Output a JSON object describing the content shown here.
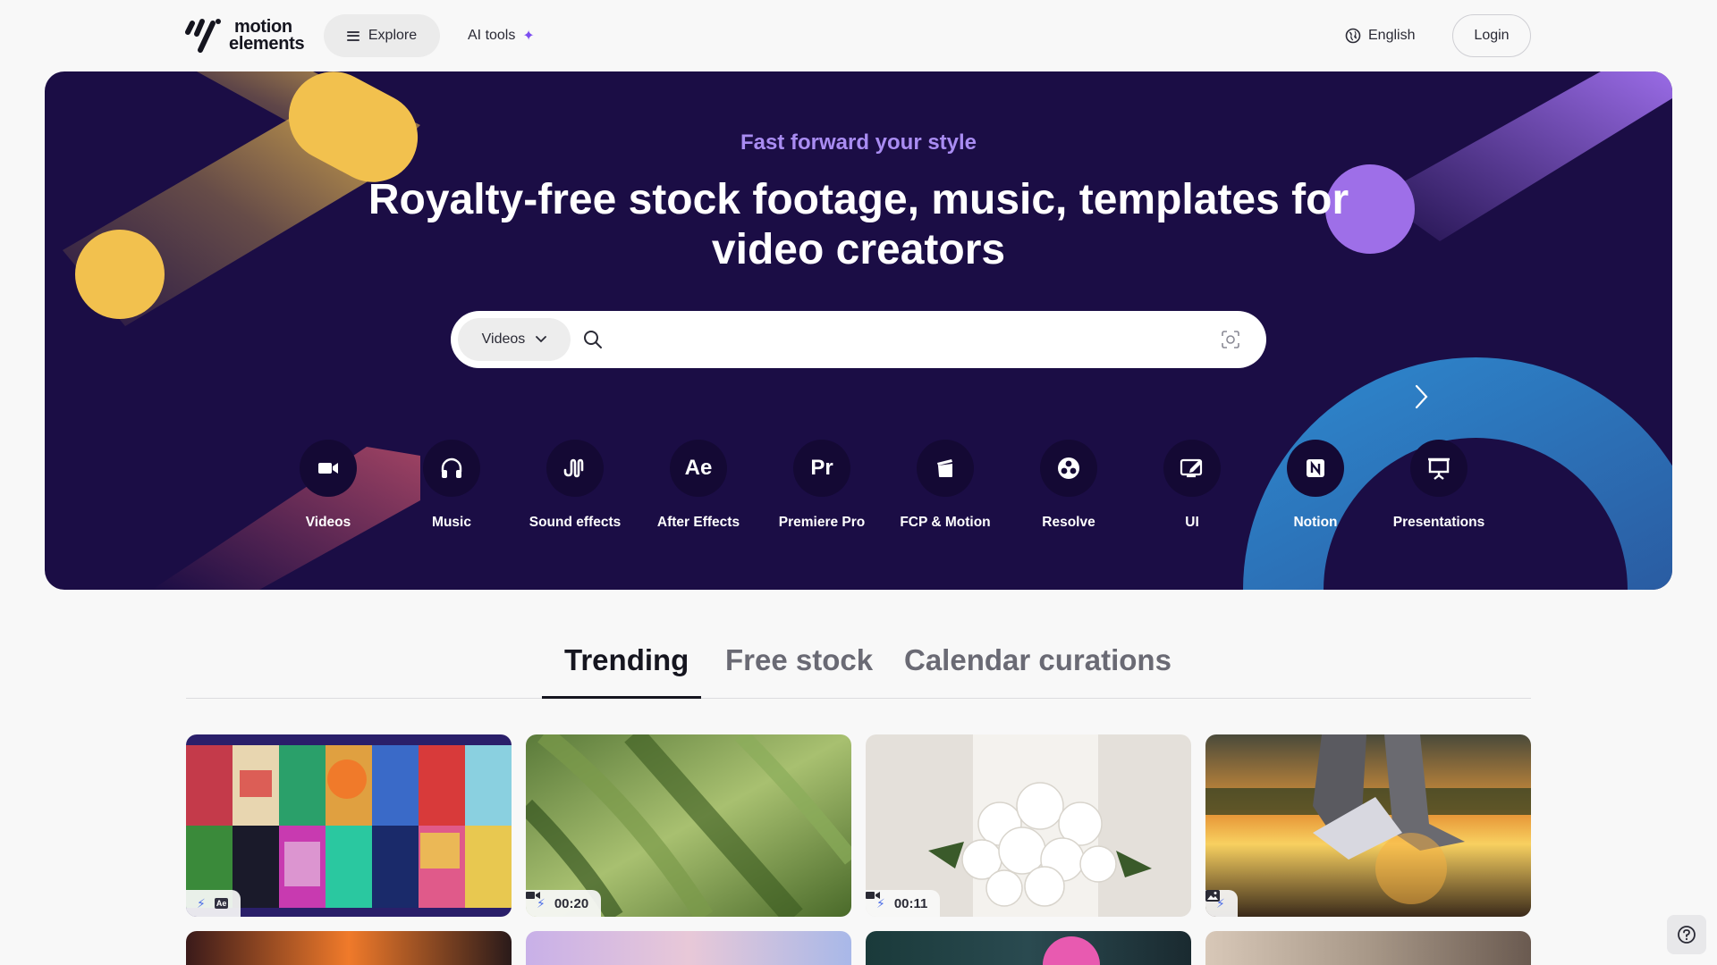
{
  "header": {
    "logo_line1": "motion",
    "logo_line2": "elements",
    "explore_label": "Explore",
    "ai_tools_label": "AI tools",
    "language_label": "English",
    "login_label": "Login"
  },
  "hero": {
    "tagline": "Fast forward your style",
    "headline": "Royalty-free stock footage, music, templates for video creators",
    "search": {
      "type_selected": "Videos",
      "placeholder": "",
      "value": ""
    },
    "categories": [
      {
        "label": "Videos",
        "icon": "video-camera-icon"
      },
      {
        "label": "Music",
        "icon": "headphones-icon"
      },
      {
        "label": "Sound effects",
        "icon": "sound-wave-icon"
      },
      {
        "label": "After Effects",
        "icon": "after-effects-icon",
        "glyph": "Ae"
      },
      {
        "label": "Premiere Pro",
        "icon": "premiere-pro-icon",
        "glyph": "Pr"
      },
      {
        "label": "FCP & Motion",
        "icon": "clapperboard-icon"
      },
      {
        "label": "Resolve",
        "icon": "resolve-icon"
      },
      {
        "label": "UI",
        "icon": "ui-edit-icon"
      },
      {
        "label": "Notion",
        "icon": "notion-icon"
      },
      {
        "label": "Presentations",
        "icon": "presentation-icon"
      }
    ]
  },
  "tabs": [
    {
      "label": "Trending",
      "active": true
    },
    {
      "label": "Free stock",
      "active": false
    },
    {
      "label": "Calendar curations",
      "active": false
    }
  ],
  "cards": [
    {
      "type": "after-effects-template",
      "duration": ""
    },
    {
      "type": "video",
      "duration": "00:20"
    },
    {
      "type": "video",
      "duration": "00:11"
    },
    {
      "type": "image",
      "duration": ""
    }
  ],
  "colors": {
    "hero_bg": "#1b0d45",
    "accent_purple": "#a98cf2",
    "accent_yellow": "#f2c14e",
    "accent_blue": "#2f7fc0",
    "bolt_blue": "#4b6de8"
  }
}
